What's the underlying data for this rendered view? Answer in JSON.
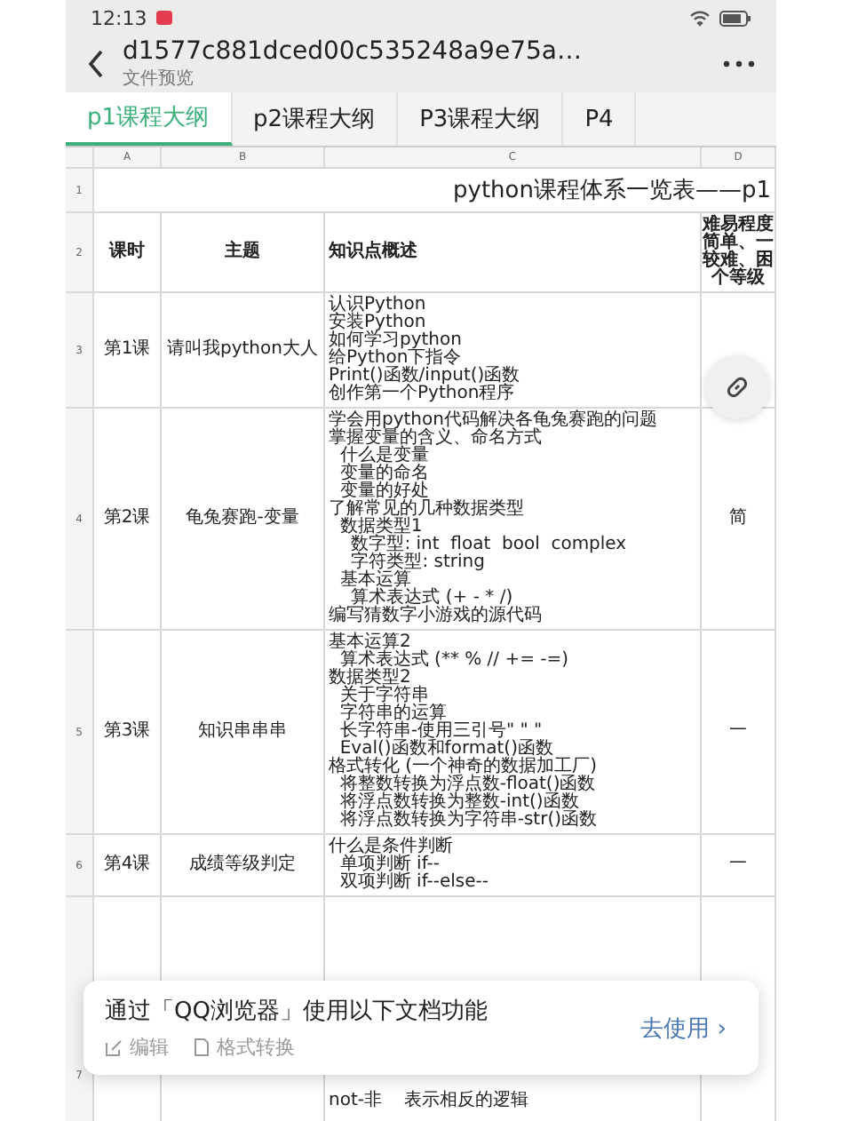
{
  "status_bar": {
    "time": "12:13"
  },
  "header": {
    "title": "d1577c881dced00c535248a9e75a…",
    "subtitle": "文件预览"
  },
  "tabs": [
    {
      "label": "p1课程大纲",
      "selected": true
    },
    {
      "label": "p2课程大纲",
      "selected": false
    },
    {
      "label": "P3课程大纲",
      "selected": false
    },
    {
      "label": "P4",
      "selected": false
    }
  ],
  "sheet": {
    "column_headers": [
      "A",
      "B",
      "C",
      "D"
    ],
    "title_row": {
      "row_number": "1",
      "text": "python课程体系一览表——p1"
    },
    "rows": [
      {
        "kind": "header",
        "row_number": "2",
        "a": [
          "课时"
        ],
        "b": [
          "主题"
        ],
        "c": [
          "知识点概述"
        ],
        "d": [
          "难易程度",
          "简单、一",
          "较难、困",
          "个等级"
        ]
      },
      {
        "kind": "lesson",
        "row_number": "3",
        "a": [
          "第1课"
        ],
        "b": [
          "请叫我python大人"
        ],
        "c": [
          "认识Python",
          "安装Python",
          "如何学习python",
          "给Python下指令",
          "Print()函数/input()函数",
          "创作第一个Python程序"
        ]
      },
      {
        "kind": "lesson",
        "row_number": "4",
        "a": [
          "第2课"
        ],
        "b": [
          "龟兔赛跑-变量"
        ],
        "c": [
          "学会用python代码解决各龟兔赛跑的问题",
          "掌握变量的含义、命名方式",
          "  什么是变量",
          "  变量的命名",
          "  变量的好处",
          "了解常见的几种数据类型",
          "  数据类型1",
          "    数字型: int  float  bool  complex",
          "    字符类型: string",
          "  基本运算",
          "    算术表达式 (+ - * /)",
          "编写猜数字小游戏的源代码"
        ],
        "d": [
          "简"
        ]
      },
      {
        "kind": "lesson",
        "row_number": "5",
        "a": [
          "第3课"
        ],
        "b": [
          "知识串串串"
        ],
        "c": [
          "基本运算2",
          "  算术表达式 (** % // += -=)",
          "数据类型2",
          "  关于字符串",
          "  字符串的运算",
          "  长字符串-使用三引号\" \" \"",
          "  Eval()函数和format()函数",
          "格式转化 (一个神奇的数据加工厂)",
          "  将整数转换为浮点数-float()函数",
          "  将浮点数转换为整数-int()函数",
          "  将浮点数转换为字符串-str()函数"
        ],
        "d": [
          "一"
        ]
      },
      {
        "kind": "lesson",
        "row_number": "6",
        "a": [
          "第4课"
        ],
        "b": [
          "成绩等级判定"
        ],
        "c": [
          "什么是条件判断",
          "  单项判断 if--",
          "  双项判断 if--else--"
        ],
        "d": [
          "一"
        ]
      },
      {
        "kind": "partial",
        "row_number": "7",
        "c": [
          "not-非    表示相反的逻辑"
        ]
      }
    ]
  },
  "banner": {
    "message": "通过「QQ浏览器」使用以下文档功能",
    "actions": [
      "编辑",
      "格式转换"
    ],
    "cta": "去使用 ›"
  }
}
